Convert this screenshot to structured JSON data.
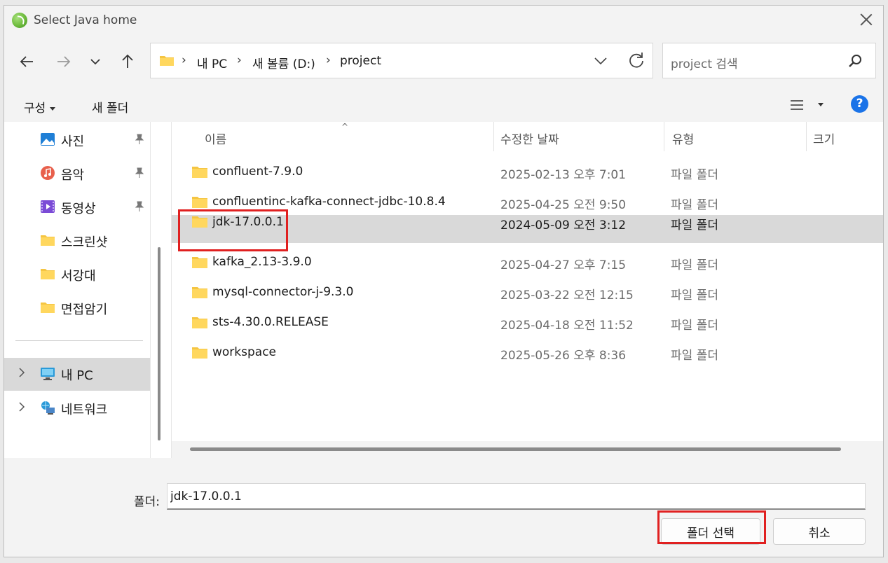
{
  "window": {
    "title": "Select Java home"
  },
  "address": {
    "crumbs": [
      "내 PC",
      "새 볼륨 (D:)",
      "project"
    ]
  },
  "search": {
    "placeholder": "project 검색"
  },
  "commands": {
    "organize": "구성",
    "new_folder": "새 폴더"
  },
  "sidebar": {
    "items": [
      {
        "label": "사진",
        "icon": "pictures-icon",
        "pinned": true
      },
      {
        "label": "음악",
        "icon": "music-icon",
        "pinned": true
      },
      {
        "label": "동영상",
        "icon": "videos-icon",
        "pinned": true
      },
      {
        "label": "스크린샷",
        "icon": "folder-icon",
        "pinned": false
      },
      {
        "label": "서강대",
        "icon": "folder-icon",
        "pinned": false
      },
      {
        "label": "면접암기",
        "icon": "folder-icon",
        "pinned": false
      }
    ],
    "tree": [
      {
        "label": "내 PC",
        "icon": "pc-icon",
        "selected": true
      },
      {
        "label": "네트워크",
        "icon": "network-icon",
        "selected": false
      }
    ]
  },
  "columns": {
    "name": "이름",
    "modified": "수정한 날짜",
    "type": "유형",
    "size": "크기"
  },
  "files": [
    {
      "name": "confluent-7.9.0",
      "modified": "2025-02-13 오후 7:01",
      "type": "파일 폴더"
    },
    {
      "name": "confluentinc-kafka-connect-jdbc-10.8.4",
      "modified": "2025-04-25 오전 9:50",
      "type": "파일 폴더"
    },
    {
      "name": "jdk-17.0.0.1",
      "modified": "2024-05-09 오전 3:12",
      "type": "파일 폴더"
    },
    {
      "name": "kafka_2.13-3.9.0",
      "modified": "2025-04-27 오후 7:15",
      "type": "파일 폴더"
    },
    {
      "name": "mysql-connector-j-9.3.0",
      "modified": "2025-03-22 오전 12:15",
      "type": "파일 폴더"
    },
    {
      "name": "sts-4.30.0.RELEASE",
      "modified": "2025-04-18 오전 11:52",
      "type": "파일 폴더"
    },
    {
      "name": "workspace",
      "modified": "2025-05-26 오후 8:36",
      "type": "파일 폴더"
    }
  ],
  "selected_file_index": 2,
  "footer": {
    "folder_label": "폴더:",
    "folder_value": "jdk-17.0.0.1",
    "select_button": "폴더 선택",
    "cancel_button": "취소"
  },
  "colors": {
    "accent": "#1a73e8",
    "highlight": "#e02020",
    "folder": "#f5c542",
    "selection": "#d9d9d9"
  }
}
